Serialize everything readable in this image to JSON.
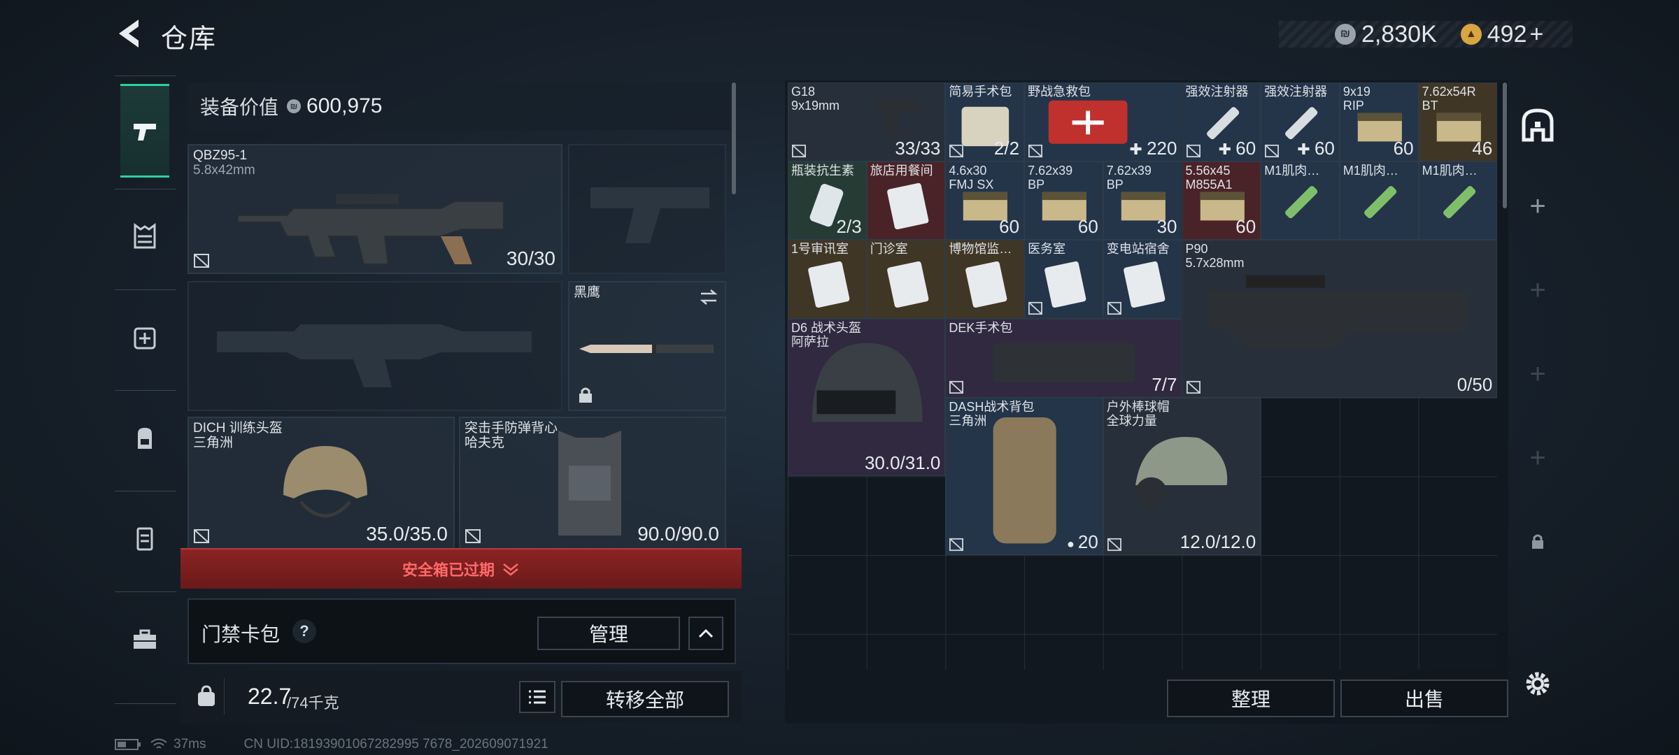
{
  "header": {
    "title": "仓库"
  },
  "currency": {
    "silver": "2,830K",
    "gold": "492",
    "gold_add": "+"
  },
  "equipment": {
    "value_label": "装备价值",
    "value": "600,975",
    "primary_weapon": {
      "name": "QBZ95-1",
      "caliber": "5.8x42mm",
      "count": "30/30"
    },
    "melee": {
      "name": "黑鹰"
    },
    "helmet": {
      "name": "DICH 训练头盔",
      "brand": "三角洲",
      "durability": "35.0/35.0"
    },
    "armor": {
      "name": "突击手防弹背心",
      "brand": "哈夫克",
      "durability": "90.0/90.0"
    },
    "safebox_notice": "安全箱已过期",
    "keycard_label": "门禁卡包",
    "manage_label": "管理",
    "weight": "22.7",
    "weight_max": "/74千克",
    "transfer_all_label": "转移全部"
  },
  "stash": {
    "items": [
      {
        "name": "G18",
        "sub": "9x19mm",
        "count": "33/33",
        "rarity": "gray"
      },
      {
        "name": "简易手术包",
        "count": "2/2",
        "rarity": "blue"
      },
      {
        "name": "野战急救包",
        "count": "220",
        "rarity": "blue"
      },
      {
        "name": "强效注射器",
        "count": "60",
        "rarity": "blue"
      },
      {
        "name": "强效注射器",
        "count": "60",
        "rarity": "blue"
      },
      {
        "name": "9x19",
        "sub": "RIP",
        "count": "60",
        "rarity": "blue"
      },
      {
        "name": "7.62x54R",
        "sub": "BT",
        "count": "46",
        "rarity": "gold"
      },
      {
        "name": "瓶装抗生素",
        "count": "2/3",
        "rarity": "green"
      },
      {
        "name": "旅店用餐间",
        "rarity": "red"
      },
      {
        "name": "4.6x30",
        "sub": "FMJ SX",
        "count": "60",
        "rarity": "blue"
      },
      {
        "name": "7.62x39",
        "sub": "BP",
        "count": "60",
        "rarity": "blue"
      },
      {
        "name": "7.62x39",
        "sub": "BP",
        "count": "30",
        "rarity": "blue"
      },
      {
        "name": "5.56x45",
        "sub": "M855A1",
        "count": "60",
        "rarity": "red"
      },
      {
        "name": "M1肌肉…",
        "rarity": "blue"
      },
      {
        "name": "M1肌肉…",
        "rarity": "blue"
      },
      {
        "name": "M1肌肉…",
        "rarity": "blue"
      },
      {
        "name": "1号审讯室",
        "rarity": "gold"
      },
      {
        "name": "门诊室",
        "rarity": "gold"
      },
      {
        "name": "博物馆监…",
        "rarity": "gold"
      },
      {
        "name": "医务室",
        "rarity": "blue"
      },
      {
        "name": "变电站宿舍",
        "rarity": "blue"
      },
      {
        "name": "P90",
        "sub": "5.7x28mm",
        "count": "0/50",
        "rarity": "gray"
      },
      {
        "name": "D6 战术头盔",
        "sub": "阿萨拉",
        "count": "30.0/31.0",
        "rarity": "purple"
      },
      {
        "name": "DEK手术包",
        "count": "7/7",
        "rarity": "purple"
      },
      {
        "name": "DASH战术背包",
        "sub": "三角洲",
        "count": "20",
        "rarity": "blue"
      },
      {
        "name": "户外棒球帽",
        "sub": "全球力量",
        "count": "12.0/12.0",
        "rarity": "gray"
      }
    ],
    "sort_label": "整理",
    "sell_label": "出售"
  },
  "status": {
    "ping": "37ms",
    "uid": "CN UID:18193901067282995 7678_202609071921"
  },
  "colors": {
    "accent": "#2fd0a0",
    "danger": "#8a2424",
    "silver_coin": "#9aa3ab",
    "gold_coin": "#d8a640"
  }
}
